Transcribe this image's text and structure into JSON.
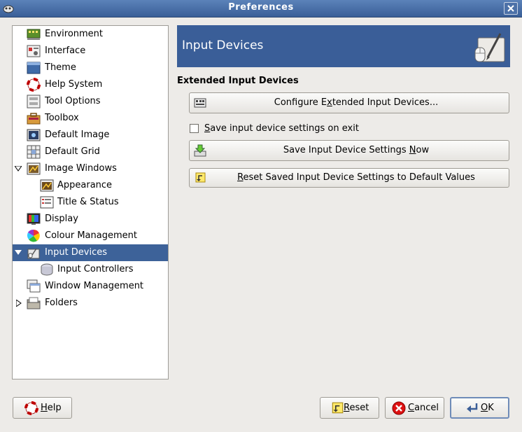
{
  "window": {
    "title": "Preferences"
  },
  "sidebar": {
    "items": [
      {
        "label": "Environment"
      },
      {
        "label": "Interface"
      },
      {
        "label": "Theme"
      },
      {
        "label": "Help System"
      },
      {
        "label": "Tool Options"
      },
      {
        "label": "Toolbox"
      },
      {
        "label": "Default Image"
      },
      {
        "label": "Default Grid"
      },
      {
        "label": "Image Windows"
      },
      {
        "label": "Appearance"
      },
      {
        "label": "Title & Status"
      },
      {
        "label": "Display"
      },
      {
        "label": "Colour Management"
      },
      {
        "label": "Input Devices"
      },
      {
        "label": "Input Controllers"
      },
      {
        "label": "Window Management"
      },
      {
        "label": "Folders"
      }
    ],
    "selected": "Input Devices"
  },
  "banner": {
    "title": "Input Devices"
  },
  "section": {
    "title": "Extended Input Devices"
  },
  "buttons": {
    "configure": {
      "pre": "Configure E",
      "mn": "x",
      "post": "tended Input Devices..."
    },
    "save_now": {
      "pre": "Save Input Device Settings ",
      "mn": "N",
      "post": "ow"
    },
    "reset_saved": {
      "pre": "",
      "mn": "R",
      "post": "eset Saved Input Device Settings to Default Values"
    }
  },
  "checkbox": {
    "pre": "",
    "mn": "S",
    "post": "ave input device settings on exit",
    "checked": false
  },
  "footer": {
    "help": {
      "mn": "H",
      "post": "elp"
    },
    "reset": {
      "mn": "R",
      "post": "eset"
    },
    "cancel": {
      "mn": "C",
      "post": "ancel"
    },
    "ok": {
      "mn": "O",
      "post": "K"
    }
  }
}
